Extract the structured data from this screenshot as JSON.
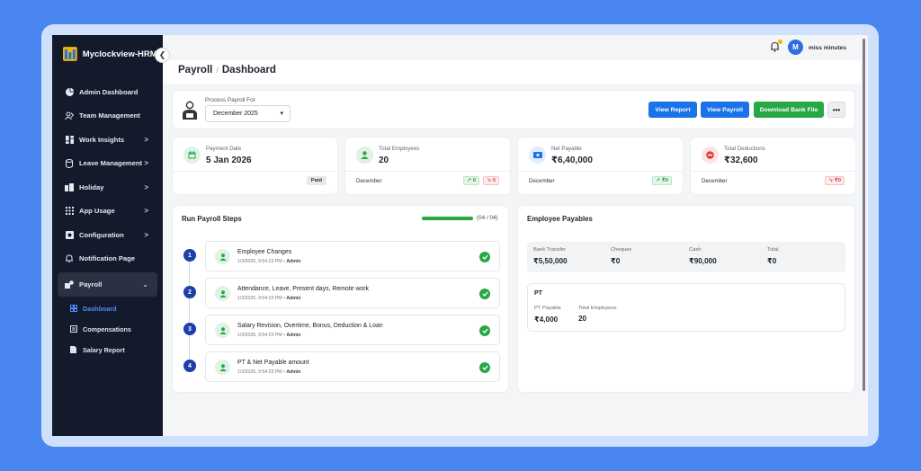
{
  "brand": {
    "name": "Myclockview-HRMS"
  },
  "colors": {
    "primary": "#1a73e8",
    "success": "#27a745",
    "sidebar": "#131a2c",
    "active_sub": "#4d8df5"
  },
  "sidebar": {
    "items": [
      {
        "label": "Admin Dashboard",
        "icon": "pie-chart-icon"
      },
      {
        "label": "Team Management",
        "icon": "users-icon"
      },
      {
        "label": "Work Insights",
        "icon": "grid-icon",
        "chevron": ">"
      },
      {
        "label": "Leave Management",
        "icon": "database-icon",
        "chevron": ">"
      },
      {
        "label": "Holiday",
        "icon": "building-icon",
        "chevron": ">"
      },
      {
        "label": "App Usage",
        "icon": "apps-icon",
        "chevron": ">"
      },
      {
        "label": "Configuration",
        "icon": "settings-icon",
        "chevron": ">"
      },
      {
        "label": "Notification Page",
        "icon": "bell-icon"
      },
      {
        "label": "Payroll",
        "icon": "payroll-icon",
        "chevron": "⌄"
      }
    ],
    "sub_items": [
      {
        "label": "Dashboard",
        "icon": "dashboard-icon"
      },
      {
        "label": "Compensations",
        "icon": "list-icon"
      },
      {
        "label": "Salary Report",
        "icon": "file-icon"
      }
    ]
  },
  "topbar": {
    "avatar_initial": "M",
    "username": "miss minutes"
  },
  "breadcrumb": {
    "parent": "Payroll",
    "separator": "/",
    "current": "Dashboard"
  },
  "process": {
    "label": "Process Payroll For",
    "month": "December 2025",
    "buttons": {
      "report": "View Report",
      "payroll": "View Payroll",
      "bank": "Download Bank File",
      "more": "•••"
    }
  },
  "stats": [
    {
      "label": "Payment Date",
      "value": "5 Jan 2026",
      "footer": "",
      "badge": "Paid"
    },
    {
      "label": "Total Employees",
      "value": "20",
      "footer": "December",
      "up": "0",
      "down": "0"
    },
    {
      "label": "Net Payable",
      "value": "₹6,40,000",
      "footer": "December",
      "up": "₹0"
    },
    {
      "label": "Total Deductions",
      "value": "₹32,600",
      "footer": "December",
      "down": "₹0"
    }
  ],
  "steps": {
    "title": "Run Payroll Steps",
    "progress_fraction": 1.0,
    "progress_text": "(04 / 04)",
    "items": [
      {
        "num": "1",
        "title": "Employee Changes",
        "date": "1/3/2026, 9:54:23 PM",
        "by": "Admin"
      },
      {
        "num": "2",
        "title": "Attendance, Leave, Present days, Remote work",
        "date": "1/3/2026, 9:54:23 PM",
        "by": "Admin"
      },
      {
        "num": "3",
        "title": "Salary Revision, Overtime, Bonus, Deduction & Loan",
        "date": "1/3/2026, 9:54:23 PM",
        "by": "Admin"
      },
      {
        "num": "4",
        "title": "PT & Net Payable amount",
        "date": "1/3/2026, 9:54:23 PM",
        "by": "Admin"
      }
    ]
  },
  "payables": {
    "title": "Employee Payables",
    "columns": [
      {
        "label": "Bank Transfer",
        "value": "₹5,50,000"
      },
      {
        "label": "Cheques",
        "value": "₹0"
      },
      {
        "label": "Cash",
        "value": "₹90,000"
      },
      {
        "label": "Total",
        "value": "₹0"
      }
    ],
    "pt": {
      "title": "PT",
      "payable_label": "PT Payable",
      "payable_value": "₹4,000",
      "employees_label": "Total Employees",
      "employees_value": "20"
    }
  }
}
